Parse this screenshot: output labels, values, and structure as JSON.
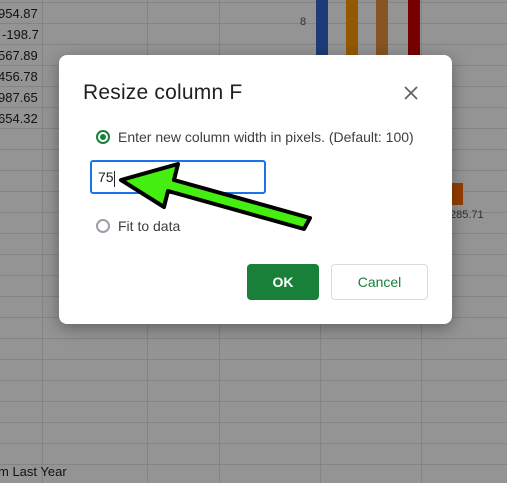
{
  "sheet": {
    "cell_values": [
      "954.87",
      "-198.7",
      "567.89",
      "456.78",
      "987.65",
      "654.32"
    ],
    "footer_label": "m Last Year",
    "chart": {
      "tick_label": "8",
      "bar_label": "285.71",
      "bar_colors": [
        "#3366cc",
        "#ff9900",
        "#e69138",
        "#cc0000"
      ],
      "small_bar_color": "#ff6d01"
    }
  },
  "dialog": {
    "title": "Resize column F",
    "close_icon": "close-icon",
    "option_width_label": "Enter new column width in pixels. (Default: 100)",
    "width_value": "75",
    "option_fit_label": "Fit to data",
    "ok_label": "OK",
    "cancel_label": "Cancel",
    "accent_color": "#188038",
    "focus_color": "#1a73e8"
  },
  "annotation": {
    "arrow_color": "#44ee11"
  }
}
